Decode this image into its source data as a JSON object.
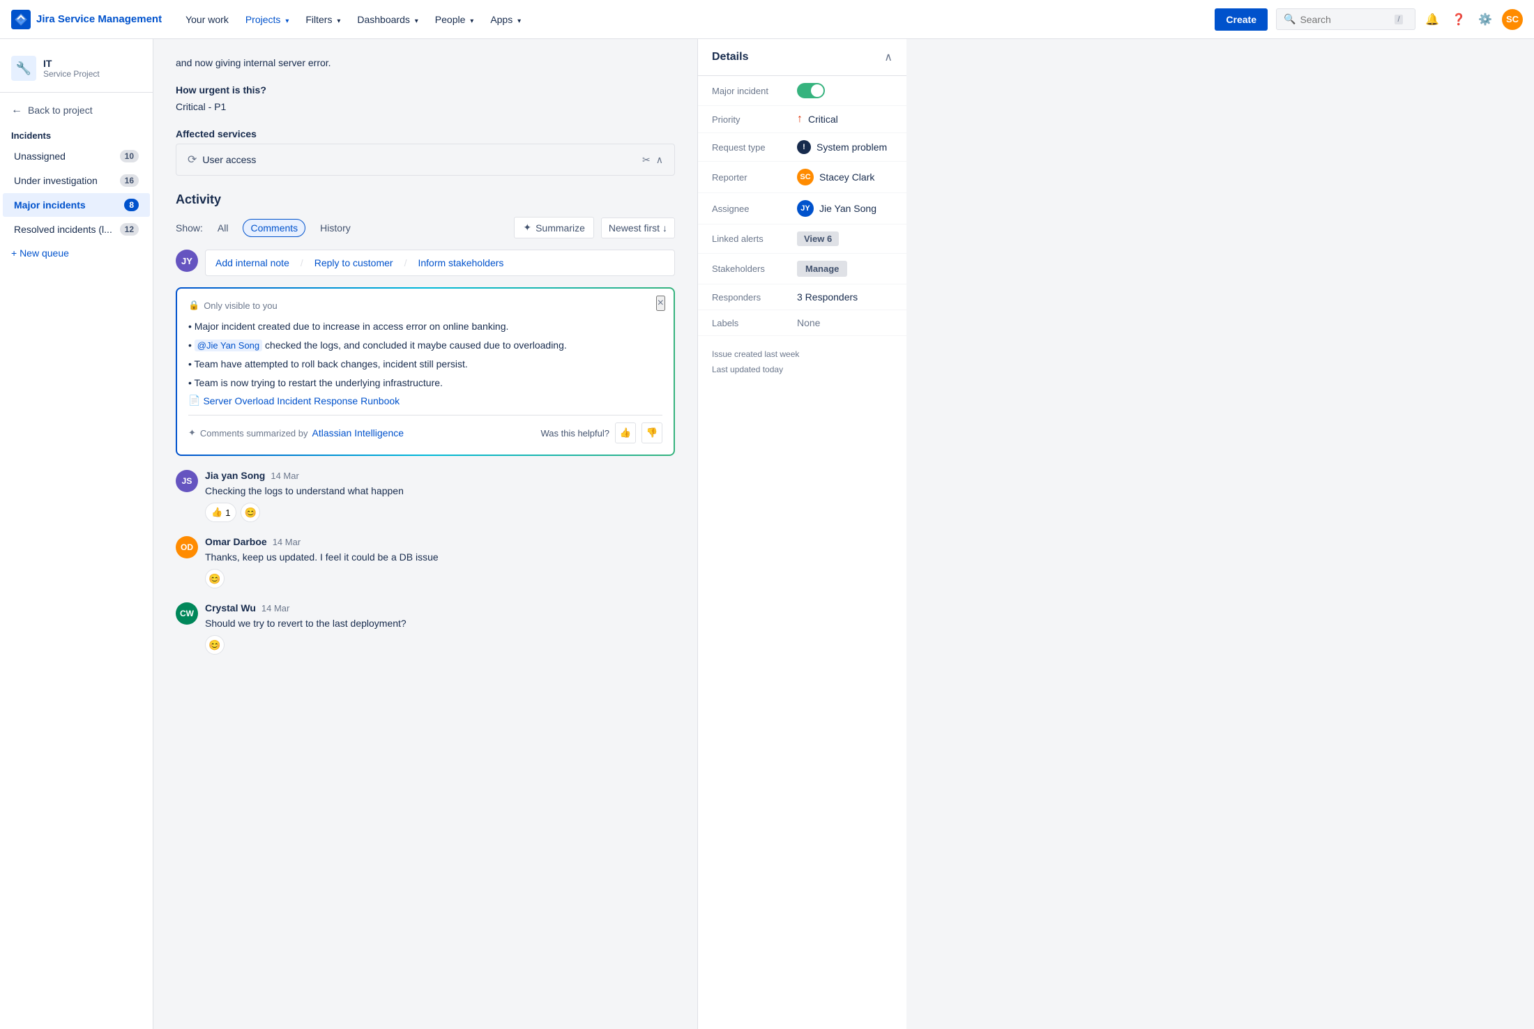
{
  "app": {
    "name": "Jira Service Management",
    "logo_icon": "⚡"
  },
  "topnav": {
    "links": [
      {
        "label": "Your work",
        "active": false
      },
      {
        "label": "Projects",
        "has_chevron": true,
        "active": false
      },
      {
        "label": "Filters",
        "has_chevron": true,
        "active": false
      },
      {
        "label": "Dashboards",
        "has_chevron": true,
        "active": false
      },
      {
        "label": "People",
        "has_chevron": true,
        "active": false
      },
      {
        "label": "Apps",
        "has_chevron": true,
        "active": false
      }
    ],
    "create_label": "Create",
    "search_placeholder": "Search",
    "search_shortcut": "/"
  },
  "sidebar": {
    "project_name": "IT",
    "project_type": "Service Project",
    "project_icon": "🔧",
    "back_label": "Back to project",
    "section_title": "Incidents",
    "items": [
      {
        "label": "Unassigned",
        "count": 10,
        "active": false
      },
      {
        "label": "Under investigation",
        "count": 16,
        "active": false
      },
      {
        "label": "Major incidents",
        "count": 8,
        "active": true
      },
      {
        "label": "Resolved incidents (l...",
        "count": 12,
        "active": false
      }
    ],
    "new_queue": "+ New queue"
  },
  "issue": {
    "body_text": "and now giving internal server error.",
    "urgency_label": "How urgent is this?",
    "urgency_value": "Critical - P1",
    "affected_label": "Affected services",
    "service_name": "User access"
  },
  "activity": {
    "title": "Activity",
    "show_label": "Show:",
    "filters": [
      {
        "label": "All",
        "active": false
      },
      {
        "label": "Comments",
        "active": true
      },
      {
        "label": "History",
        "active": false
      }
    ],
    "summarize_label": "Summarize",
    "newest_label": "Newest first",
    "comment_actions": [
      "Add internal note",
      "Reply to customer",
      "Inform stakeholders"
    ],
    "ai_box": {
      "visibility": "Only visible to you",
      "bullets": [
        "Major incident created due to increase in access error on online banking.",
        " checked the logs, and concluded it maybe caused due to overloading.",
        "Team have attempted to roll back changes, incident still persist.",
        "Team is now trying to restart the underlying infrastructure."
      ],
      "mention": "@Jie Yan Song",
      "doc_link": "Server Overload Incident Response Runbook",
      "footer_credit": "Comments summarized by",
      "footer_ai": "Atlassian Intelligence",
      "helpful_label": "Was this helpful?"
    },
    "comments": [
      {
        "author": "Jia yan Song",
        "date": "14 Mar",
        "text": "Checking the logs to understand what happen",
        "avatar_color": "#6554c0",
        "avatar_initials": "JS",
        "reactions": [
          {
            "emoji": "👍",
            "count": 1
          }
        ],
        "has_emoji_add": true
      },
      {
        "author": "Omar Darboe",
        "date": "14 Mar",
        "text": "Thanks, keep us updated. I feel it could be a DB issue",
        "avatar_color": "#ff8b00",
        "avatar_initials": "OD",
        "reactions": [],
        "has_emoji_add": true
      },
      {
        "author": "Crystal Wu",
        "date": "14 Mar",
        "text": "Should we try to revert to the last deployment?",
        "avatar_color": "#00875a",
        "avatar_initials": "CW",
        "reactions": [],
        "has_emoji_add": true
      }
    ]
  },
  "details": {
    "title": "Details",
    "rows": [
      {
        "label": "Major incident",
        "type": "toggle",
        "value": true
      },
      {
        "label": "Priority",
        "type": "priority",
        "value": "Critical"
      },
      {
        "label": "Request type",
        "type": "request",
        "value": "System problem"
      },
      {
        "label": "Reporter",
        "type": "person",
        "value": "Stacey Clark"
      },
      {
        "label": "Assignee",
        "type": "person",
        "value": "Jie Yan Song"
      },
      {
        "label": "Linked alerts",
        "type": "view",
        "value": "View 6"
      },
      {
        "label": "Stakeholders",
        "type": "manage",
        "value": "Manage"
      },
      {
        "label": "Responders",
        "type": "text",
        "value": "3 Responders"
      },
      {
        "label": "Labels",
        "type": "none",
        "value": "None"
      }
    ],
    "meta_created": "Issue created last week",
    "meta_updated": "Last updated today"
  }
}
